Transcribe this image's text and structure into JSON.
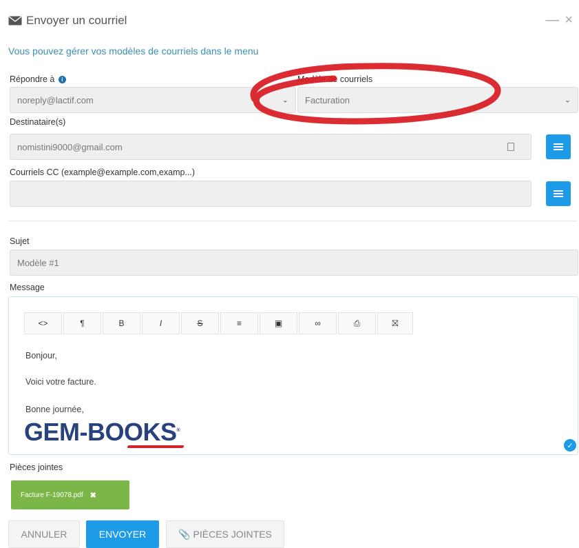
{
  "dialog": {
    "title": "Envoyer un courriel",
    "minimize_glyph": "—",
    "close_glyph": "×",
    "info_text": "Vous pouvez gérer vos modèles de courriels dans le menu"
  },
  "reply_to": {
    "label": "Répondre à",
    "value": "noreply@lactif.com"
  },
  "template": {
    "label": "Modèle de courriels",
    "value": "Facturation"
  },
  "recipients": {
    "label": "Destinataire(s)",
    "value": "nomistini9000@gmail.com"
  },
  "cc": {
    "label": "Courriels CC (example@example.com,examp...)",
    "value": ""
  },
  "subject": {
    "label": "Sujet",
    "value": "Modèle #1"
  },
  "message": {
    "label": "Message",
    "toolbar": [
      "<>",
      "¶",
      "B",
      "I",
      "S",
      "≡",
      "▣",
      "∞",
      "⎙",
      "⛝"
    ],
    "lines": [
      "Bonjour,",
      "Voici votre facture.",
      "Bonne journée,"
    ],
    "logo_text": "GEM-BOOKS",
    "logo_mark": "®"
  },
  "attachments": {
    "label": "Pièces jointes",
    "files": [
      {
        "name": "Facture F-19078.pdf",
        "remove_glyph": "✖"
      }
    ]
  },
  "buttons": {
    "cancel": "ANNULER",
    "send": "ENVOYER",
    "attach": "PIÈCES JOINTES"
  },
  "colors": {
    "accent": "#1e9be6",
    "attachment_chip": "#7ab648",
    "annotation": "#d71a21",
    "logo": "#28427d"
  }
}
